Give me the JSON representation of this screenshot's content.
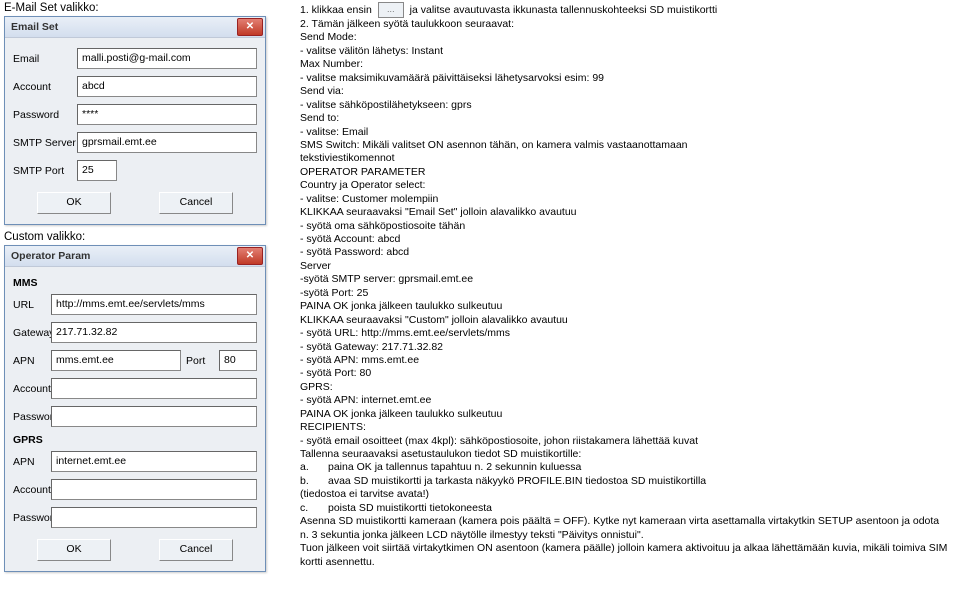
{
  "left": {
    "email_set_label": "E-Mail Set valikko:",
    "custom_label": "Custom valikko:"
  },
  "email_dialog": {
    "title": "Email Set",
    "fields": {
      "email_lbl": "Email",
      "email_val": "malli.posti@g-mail.com",
      "account_lbl": "Account",
      "account_val": "abcd",
      "password_lbl": "Password",
      "password_val": "****",
      "smtp_lbl": "SMTP Server",
      "smtp_val": "gprsmail.emt.ee",
      "port_lbl": "SMTP Port",
      "port_val": "25"
    },
    "ok": "OK",
    "cancel": "Cancel"
  },
  "custom_dialog": {
    "title": "Operator Param",
    "mms_header": "MMS",
    "fields": {
      "url_lbl": "URL",
      "url_val": "http://mms.emt.ee/servlets/mms",
      "gw_lbl": "Gateway",
      "gw_val": "217.71.32.82",
      "apn_lbl": "APN",
      "apn_val": "mms.emt.ee",
      "port_lbl": "Port",
      "port_val": "80",
      "acc_lbl": "Account",
      "acc_val": "",
      "pwd_lbl": "Password",
      "pwd_val": ""
    },
    "gprs_header": "GPRS",
    "gprs_fields": {
      "apn_lbl": "APN",
      "apn_val": "internet.emt.ee",
      "acc_lbl": "Account",
      "acc_val": "",
      "pwd_lbl": "Password",
      "pwd_val": ""
    },
    "ok": "OK",
    "cancel": "Cancel"
  },
  "instr": {
    "l1a": "1.     klikkaa ensin ",
    "l1b": " ja valitse avautuvasta ikkunasta tallennuskohteeksi SD muistikortti",
    "l2": "2.     Tämän jälkeen syötä taulukkoon seuraavat:",
    "l3": "Send Mode:",
    "l4": " - valitse välitön lähetys: Instant",
    "l5": "Max Number:",
    "l6": " - valitse maksimikuvamäärä päivittäiseksi lähetysarvoksi esim: 99",
    "l7": "Send via:",
    "l8": " - valitse sähköpostilähetykseen: gprs",
    "l9": "Send to:",
    "l10": " - valitse: Email",
    "l11": "SMS Switch: Mikäli valitset ON asennon tähän, on kamera valmis vastaanottamaan",
    "l12": "tekstiviestikomennot",
    "l13": "OPERATOR PARAMETER",
    "l14": "Country ja Operator select:",
    "l15": " - valitse: Customer molempiin",
    "l16": "KLIKKAA seuraavaksi \"Email Set\" jolloin alavalikko avautuu",
    "l17": " - syötä oma sähköpostiosoite tähän",
    "l18": " - syötä Account: abcd",
    "l19": "  - syötä Password: abcd",
    "l20": "Server",
    "l21": " -syötä SMTP server: gprsmail.emt.ee",
    "l22": " -syötä Port: 25",
    "l23": "PAINA OK jonka jälkeen taulukko sulkeutuu",
    "l24": "KLIKKAA seuraavaksi \"Custom\" jolloin alavalikko avautuu",
    "l25": " - syötä URL: http://mms.emt.ee/servlets/mms",
    "l26": " - syötä Gateway: 217.71.32.82",
    "l27": "  - syötä APN: mms.emt.ee",
    "l28": " - syötä Port: 80",
    "l29": "GPRS:",
    "l30": " - syötä APN: internet.emt.ee",
    "l31": "PAINA OK jonka jälkeen taulukko sulkeutuu",
    "l32": "RECIPIENTS:",
    "l33": " - syötä email osoitteet (max 4kpl): sähköpostiosoite, johon riistakamera lähettää kuvat",
    "l34": "Tallenna seuraavaksi asetustaulukon tiedot SD muistikortille:",
    "l35a": "a.",
    "l35b": "paina OK  ja tallennus tapahtuu n. 2 sekunnin kuluessa",
    "l36a": "b.",
    "l36b": "avaa SD muistikortti ja tarkasta näkyykö PROFILE.BIN tiedostoa SD muistikortilla",
    "l37": "(tiedostoa ei tarvitse avata!)",
    "l38a": "c.",
    "l38b": "poista SD muistikortti tietokoneesta",
    "p2a": "Asenna SD muistikortti kameraan (kamera pois päältä = OFF). Kytke nyt kameraan virta asettamalla virtakytkin SETUP asentoon ja odota n. 3 sekuntia jonka jälkeen LCD näytölle ilmestyy teksti \"Päivitys onnistui\".",
    "p2b": "Tuon jälkeen voit siirtää virtakytkimen ON asentoon (kamera päälle) jolloin kamera aktivoituu ja alkaa lähettämään kuvia, mikäli toimiva SIM kortti asennettu."
  }
}
